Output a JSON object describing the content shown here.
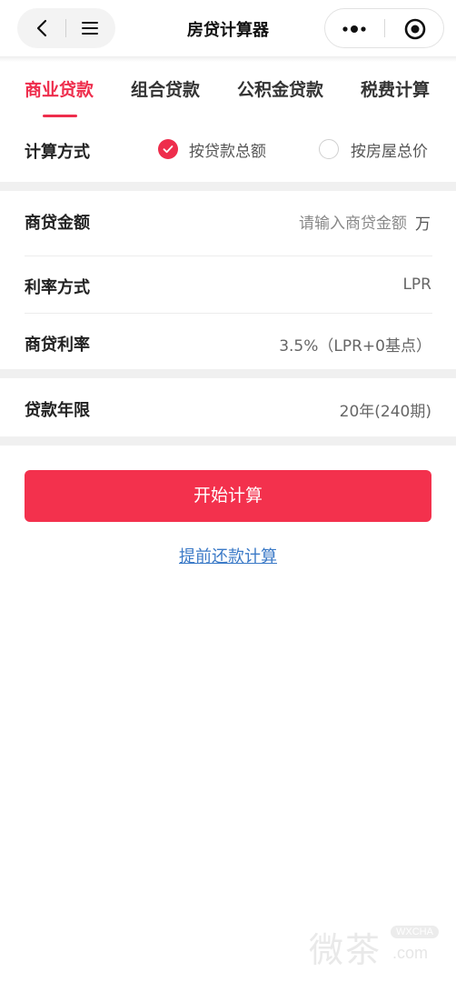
{
  "nav": {
    "title": "房贷计算器"
  },
  "tabs": [
    {
      "label": "商业贷款",
      "active": true
    },
    {
      "label": "组合贷款",
      "active": false
    },
    {
      "label": "公积金贷款",
      "active": false
    },
    {
      "label": "税费计算",
      "active": false
    }
  ],
  "method": {
    "label": "计算方式",
    "options": [
      {
        "label": "按贷款总额",
        "checked": true
      },
      {
        "label": "按房屋总价",
        "checked": false
      }
    ]
  },
  "amount": {
    "label": "商贷金额",
    "placeholder": "请输入商贷金额",
    "value": "",
    "unit": "万"
  },
  "rate_mode": {
    "label": "利率方式",
    "value": "LPR"
  },
  "rate": {
    "label": "商贷利率",
    "value": "3.5%（LPR+0基点）"
  },
  "term": {
    "label": "贷款年限",
    "value": "20年(240期)"
  },
  "calc_button": "开始计算",
  "prepay_link": "提前还款计算",
  "watermark": {
    "text": "微茶",
    "badge": "WXCHA",
    "domain": ".com"
  },
  "colors": {
    "accent": "#ee2d4c",
    "button": "#f3314d",
    "link": "#3b7ac7",
    "section_gap": "#f0f0f0"
  }
}
